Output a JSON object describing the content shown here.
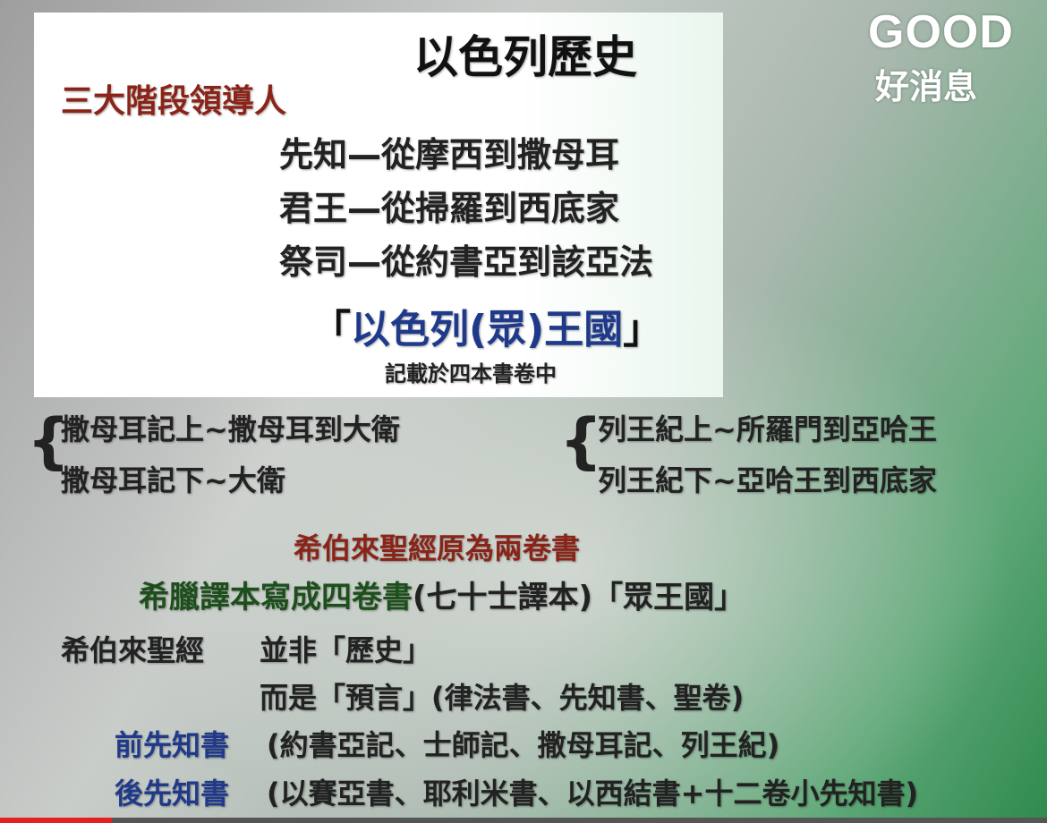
{
  "slide": {
    "title": "以色列歷史",
    "subtitle_red": "三大階段領導人",
    "leaders": [
      "先知—從摩西到撒母耳",
      "君王—從掃羅到西底家",
      "祭司—從約書亞到該亞法"
    ],
    "kingdom_open": "「",
    "kingdom_blue": "以色列(眾)王國",
    "kingdom_close": "」",
    "kingdom_note": "記載於四本書卷中",
    "samuel": [
      "撒母耳記上~撒母耳到大衛",
      "撒母耳記下~大衛"
    ],
    "kings": [
      "列王紀上~所羅門到亞哈王",
      "列王紀下~亞哈王到西底家"
    ],
    "brace_glyph": "{",
    "hebrew_two_books": "希伯來聖經原為兩卷書",
    "greek_green": "希臘譯本寫成四卷書",
    "greek_dark": "(七十士譯本)「眾王國」",
    "hebrew_bible": "希伯來聖經",
    "not_history": "並非「歷史」",
    "but_prophecy": "而是「預言」(律法書、先知書、聖卷)",
    "former_label": "前先知書",
    "former_list": "(約書亞記、士師記、撒母耳記、列王紀)",
    "latter_label": "後先知書",
    "latter_list": "(以賽亞書、耶利米書、以西結書+十二卷小先知書)"
  },
  "logo": {
    "brand": "GOOD",
    "subtitle": "好消息"
  },
  "player": {
    "progress_fraction": 0.107
  },
  "colors": {
    "accent_red": "#8b2418",
    "accent_blue": "#1f3a8a",
    "accent_green": "#1d4f1d",
    "progress_red": "#e5201e"
  }
}
